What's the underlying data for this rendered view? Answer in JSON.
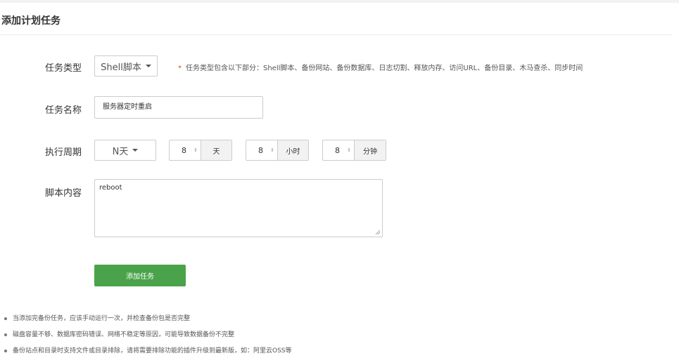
{
  "header": {
    "title": "添加计划任务"
  },
  "form": {
    "task_type": {
      "label": "任务类型",
      "selected": "Shell脚本",
      "hint_star": "*",
      "hint": "任务类型包含以下部分：Shell脚本、备份网站、备份数据库、日志切割、释放内存、访问URL、备份目录、木马查杀、同步时间"
    },
    "task_name": {
      "label": "任务名称",
      "value": "服务器定时重启"
    },
    "cycle": {
      "label": "执行周期",
      "selected": "N天",
      "day": {
        "value": "8",
        "unit": "天"
      },
      "hour": {
        "value": "8",
        "unit": "小时"
      },
      "minute": {
        "value": "8",
        "unit": "分钟"
      }
    },
    "script": {
      "label": "脚本内容",
      "value": "reboot"
    },
    "submit_label": "添加任务"
  },
  "tips": [
    "当添加完备份任务，应该手动运行一次，并检查备份包是否完整",
    "磁盘容量不够、数据库密码错误、网络不稳定等原因，可能导致数据备份不完整",
    "备份站点和目录时支持文件或目录排除，请将需要排除功能的插件升级到最新版，如：阿里云OSS等"
  ],
  "colors": {
    "primary_button": "#4aa34a",
    "required_star": "#e5432d"
  }
}
